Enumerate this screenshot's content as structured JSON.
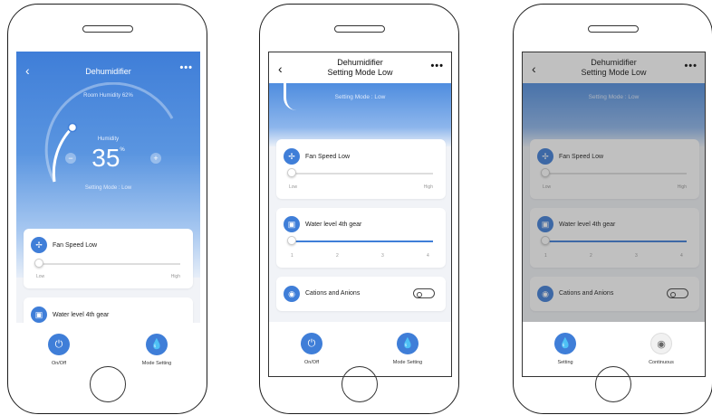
{
  "colors": {
    "accent": "#3f7ed8"
  },
  "screen1": {
    "title": "Dehumidifier",
    "more": "•••",
    "back": "‹",
    "room_humidity": "Room Humidity 62%",
    "humidity_label": "Humidity",
    "humidity_value": "35",
    "humidity_unit": "%",
    "minus": "−",
    "plus": "+",
    "setting_mode": "Setting Mode  :  Low",
    "fan_label": "Fan Speed  Low",
    "fan_low": "Low",
    "fan_high": "High",
    "water_label": "Water level  4th gear",
    "btn_onoff": "On/Off",
    "btn_mode": "Mode  Setting"
  },
  "screen2": {
    "title_line1": "Dehumidifier",
    "title_line2": "Setting Mode Low",
    "more": "•••",
    "back": "‹",
    "setting_mode": "Setting Mode  :  Low",
    "fan_label": "Fan Speed  Low",
    "fan_low": "Low",
    "fan_high": "High",
    "water_label": "Water level  4th gear",
    "water_ticks": [
      "1",
      "2",
      "3",
      "4"
    ],
    "ions_label": "Cations and Anions",
    "btn_onoff": "On/Off",
    "btn_mode": "Mode  Setting"
  },
  "screen3": {
    "title_line1": "Dehumidifier",
    "title_line2": "Setting Mode Low",
    "more": "•••",
    "back": "‹",
    "setting_mode": "Setting Mode  :  Low",
    "fan_label": "Fan Speed  Low",
    "fan_low": "Low",
    "fan_high": "High",
    "water_label": "Water level  4th gear",
    "water_ticks": [
      "1",
      "2",
      "3",
      "4"
    ],
    "ions_label": "Cations and Anions",
    "btn_setting": "Setting",
    "btn_continuous": "Continuous"
  },
  "icons": {
    "fan": "✢",
    "water": "▣",
    "ions": "◉",
    "power": "⏻",
    "drop": "💧"
  },
  "state": {
    "fan_speed_level": 0.0,
    "water_level_gear": 4,
    "ions_on": false
  }
}
